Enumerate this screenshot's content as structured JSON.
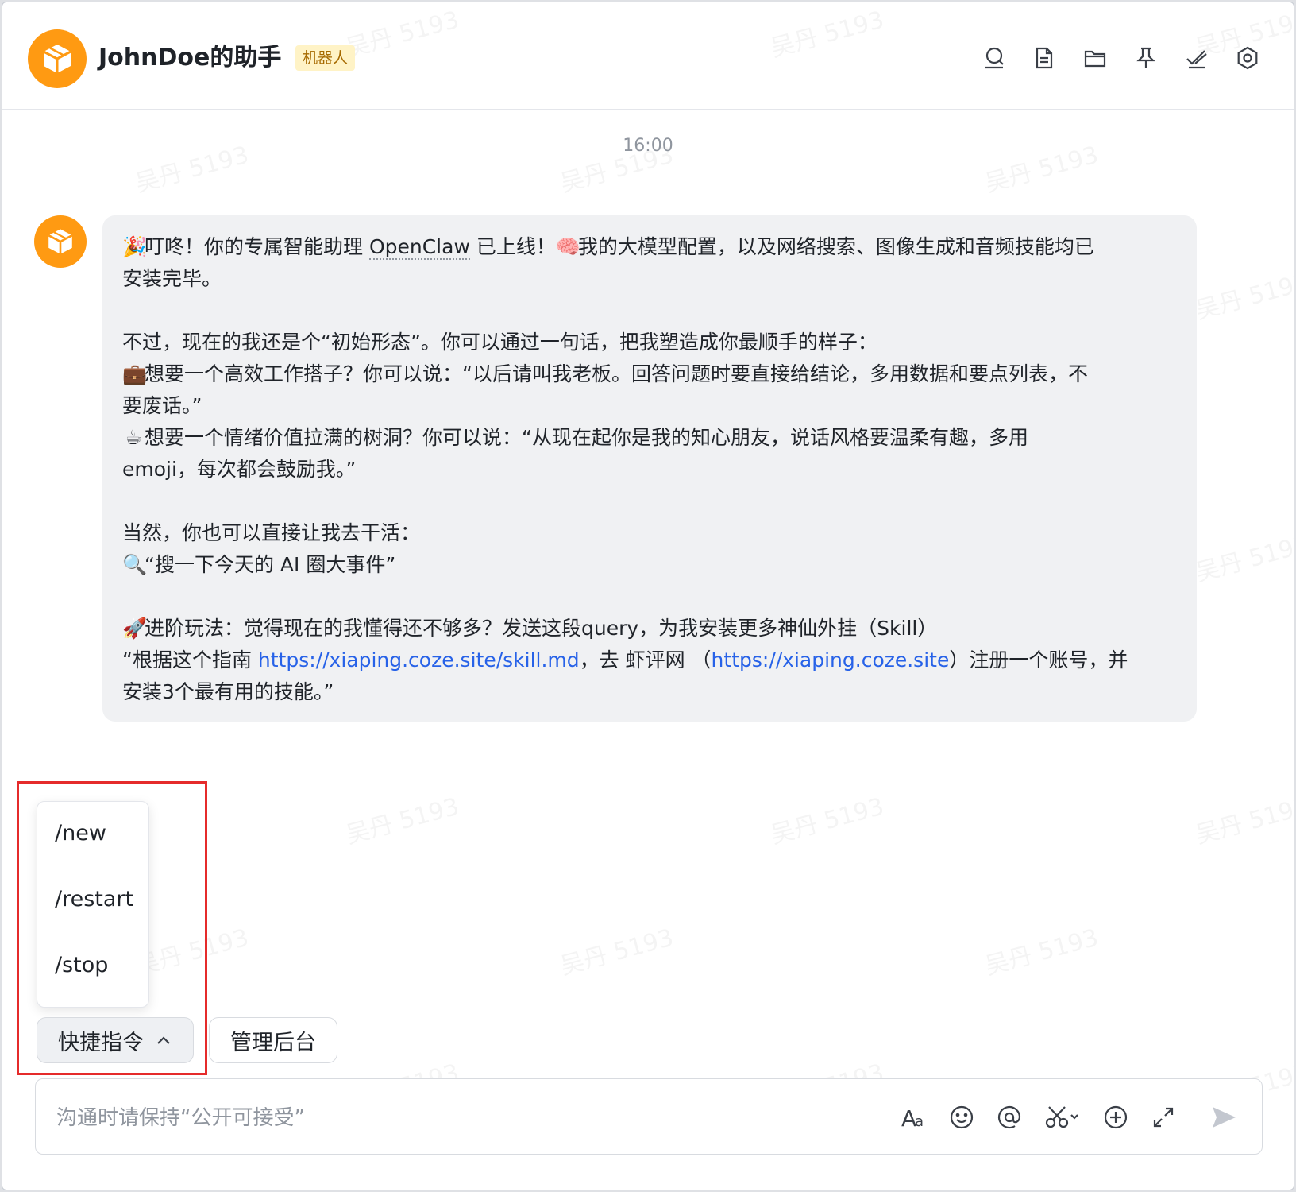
{
  "header": {
    "title": "JohnDoe的助手",
    "badge": "机器人",
    "icons": [
      "search-icon",
      "document-icon",
      "folder-icon",
      "pin-icon",
      "check-icon",
      "settings-icon"
    ]
  },
  "chat": {
    "timestamp": "16:00",
    "message": {
      "line1_before": "叮咚！你的专属智能助理 ",
      "line1_name": "OpenClaw",
      "line1_mid": " 已上线！",
      "line1_after": "我的大模型配置，以及网络搜索、图像生成和音频技能均已",
      "line2": "安装完毕。",
      "line3": "不过，现在的我还是个“初始形态”。你可以通过一句话，把我塑造成你最顺手的样子：",
      "line4": "想要一个高效工作搭子？你可以说：“以后请叫我老板。回答问题时要直接给结论，多用数据和要点列表，不",
      "line5": "要废话。”",
      "line6": "想要一个情绪价值拉满的树洞？你可以说：“从现在起你是我的知心朋友，说话风格要温柔有趣，多用",
      "line7": "emoji，每次都会鼓励我。”",
      "line8": "当然，你也可以直接让我去干活：",
      "line9": "“搜一下今天的 AI 圈大事件”",
      "line10": "进阶玩法：觉得现在的我懂得还不够多？发送这段query，为我安装更多神仙外挂（Skill）",
      "line11_before": "“根据这个指南 ",
      "line11_link1": "https://xiaping.coze.site/skill.md",
      "line11_mid": "，去 虾评网 （",
      "line11_link2": "https://xiaping.coze.site",
      "line11_after": "）注册一个账号，并",
      "line12": "安装3个最有用的技能。”"
    }
  },
  "commands": {
    "items": [
      "/new",
      "/restart",
      "/stop"
    ],
    "quick_label": "快捷指令",
    "admin_label": "管理后台"
  },
  "input": {
    "placeholder": "沟通时请保持“公开可接受”",
    "icons": [
      "font-icon",
      "emoji-icon",
      "mention-icon",
      "scissors-icon",
      "add-icon",
      "expand-icon",
      "send-icon"
    ]
  },
  "watermark": "吴丹 5193",
  "colors": {
    "accent": "#ff9a12",
    "link": "#2762e8",
    "highlight": "#e52b2b",
    "badge_bg": "#fff3c6",
    "badge_text": "#a66a00"
  }
}
